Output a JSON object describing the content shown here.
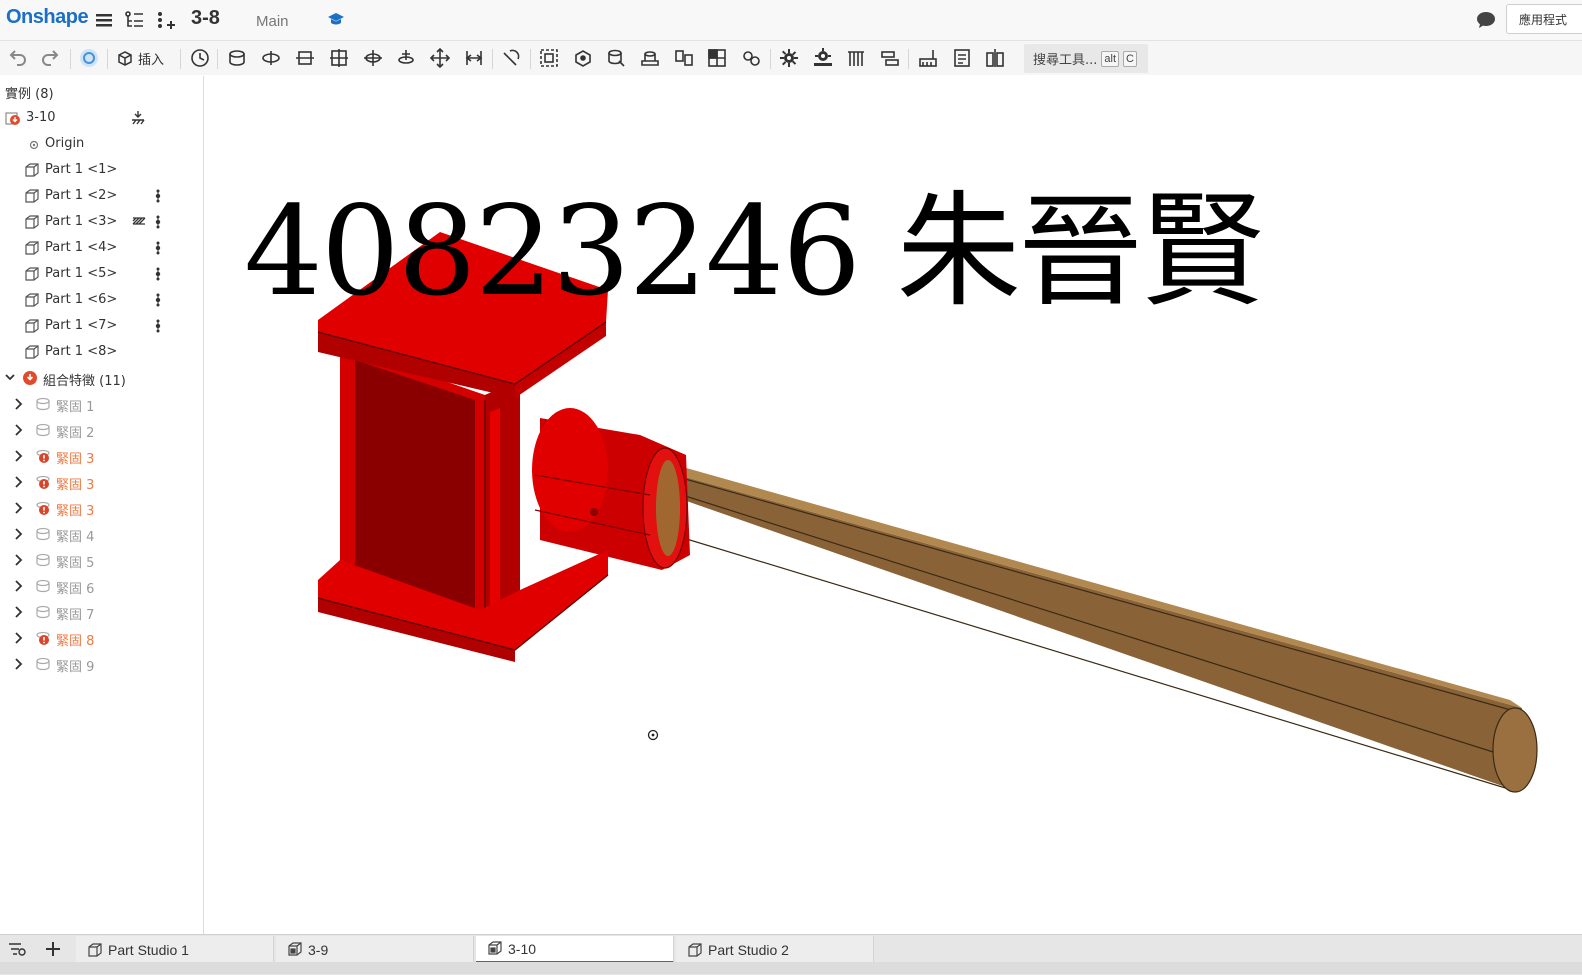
{
  "header": {
    "logo": "Onshape",
    "doc_title": "3-8",
    "branch": "Main",
    "apps_button": "應用程式"
  },
  "toolbar": {
    "insert_label": "插入",
    "search_tools_label": "搜尋工具...",
    "search_shortcut_1": "alt",
    "search_shortcut_2": "C"
  },
  "tree": {
    "instances_header": "實例 (8)",
    "root": "3-10",
    "origin": "Origin",
    "parts": [
      "Part 1 <1>",
      "Part 1 <2>",
      "Part 1 <3>",
      "Part 1 <4>",
      "Part 1 <5>",
      "Part 1 <6>",
      "Part 1 <7>",
      "Part 1 <8>"
    ],
    "mates_header": "組合特徵 (11)",
    "mates": [
      {
        "label": "緊固 1",
        "status": "ok"
      },
      {
        "label": "緊固 2",
        "status": "ok"
      },
      {
        "label": "緊固 3",
        "status": "error"
      },
      {
        "label": "緊固 3",
        "status": "error"
      },
      {
        "label": "緊固 3",
        "status": "error"
      },
      {
        "label": "緊固 4",
        "status": "ok"
      },
      {
        "label": "緊固 5",
        "status": "ok"
      },
      {
        "label": "緊固 6",
        "status": "ok"
      },
      {
        "label": "緊固 7",
        "status": "ok"
      },
      {
        "label": "緊固 8",
        "status": "error"
      },
      {
        "label": "緊固 9",
        "status": "ok"
      }
    ]
  },
  "viewport": {
    "overlay_text": "40823246 朱晉賢"
  },
  "tabs": [
    {
      "label": "Part Studio 1",
      "active": false
    },
    {
      "label": "3-9",
      "active": false
    },
    {
      "label": "3-10",
      "active": true
    },
    {
      "label": "Part Studio 2",
      "active": false
    }
  ],
  "colors": {
    "brand": "#1c6fc7",
    "hammer_head": "#e00000",
    "handle": "#9a7040",
    "error": "#d9442a"
  }
}
